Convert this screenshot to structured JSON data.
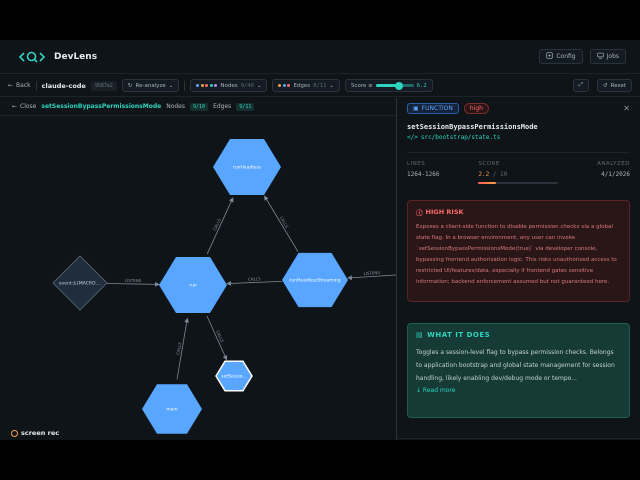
{
  "app": {
    "brand": "DevLens",
    "config_label": "Config",
    "jobs_label": "Jobs"
  },
  "toolbar": {
    "back_label": "Back",
    "repo": "claude-code",
    "hash": "9587e2",
    "reanalyze_label": "Re-analyze",
    "nodes_label": "Nodes",
    "nodes_count": "9/40",
    "edges_label": "Edges",
    "edges_count": "8/11",
    "score_label": "Score ≥",
    "score_value": "6.2",
    "score_fraction": 0.62,
    "reset_label": "Reset"
  },
  "graph_header": {
    "close_label": "Close",
    "function_name": "setSessionBypassPermissionsMode",
    "nodes_label": "Nodes",
    "nodes_count": "9/10",
    "edges_label": "Edges",
    "edges_count": "9/11"
  },
  "graph": {
    "nodes": [
      {
        "id": "runHeadless",
        "label": "runHeadless",
        "shape": "hexagon"
      },
      {
        "id": "run",
        "label": "run",
        "shape": "hexagon"
      },
      {
        "id": "runHeadlessStreaming",
        "label": "runHeadlessStreaming",
        "shape": "hexagon"
      },
      {
        "id": "event",
        "label": "event:${MACRO....",
        "shape": "diamond"
      },
      {
        "id": "main",
        "label": "main",
        "shape": "hexagon"
      },
      {
        "id": "setSession",
        "label": "setSessio...",
        "shape": "hexagon-selected"
      }
    ],
    "edges": [
      {
        "from": "run",
        "to": "runHeadless",
        "label": "CALLS"
      },
      {
        "from": "runHeadlessStreaming",
        "to": "runHeadless",
        "label": "CALLS"
      },
      {
        "from": "runHeadlessStreaming",
        "to": "run",
        "label": "CALLS"
      },
      {
        "from": "event",
        "to": "run",
        "label": "LISTENS"
      },
      {
        "from": "offscreen",
        "to": "runHeadlessStreaming",
        "label": "LISTENS"
      },
      {
        "from": "main",
        "to": "run",
        "label": "CALLS"
      },
      {
        "from": "run",
        "to": "setSession",
        "label": "CALLS"
      }
    ],
    "colors": {
      "node": "#58a6ff",
      "selected_stroke": "#ffffff",
      "diamond": "#1f2d3d",
      "edge": "#7d8896"
    }
  },
  "panel": {
    "type_badge": "FUNCTION",
    "risk_badge": "high",
    "title": "setSessionBypassPermissionsMode",
    "path": "src/bootstrap/state.ts",
    "lines_label": "LINES",
    "lines_value": "1264-1266",
    "score_label": "SCORE",
    "score_value": "2.2",
    "score_max": "/ 10",
    "score_fraction": 0.22,
    "analyzed_label": "ANALYZED",
    "analyzed_value": "4/1/2026",
    "risk_title": "HIGH RISK",
    "risk_text": "Exposes a client-side function to disable permission checks via a global state flag. In a browser environment, any user can invoke `setSessionBypassPermissionsMode(true)` via developer console, bypassing frontend authorization logic. This risks unauthorized access to restricted UI/features/data, especially if frontend gates sensitive information; backend enforcement assumed but not guaranteed here.",
    "what_title": "WHAT IT DOES",
    "what_text": "Toggles a session-level flag to bypass permission checks. Belongs to application bootstrap and global state management for session handling, likely enabling dev/debug mode or tempo...",
    "read_more": "↓ Read more"
  },
  "watermark": "screen rec"
}
